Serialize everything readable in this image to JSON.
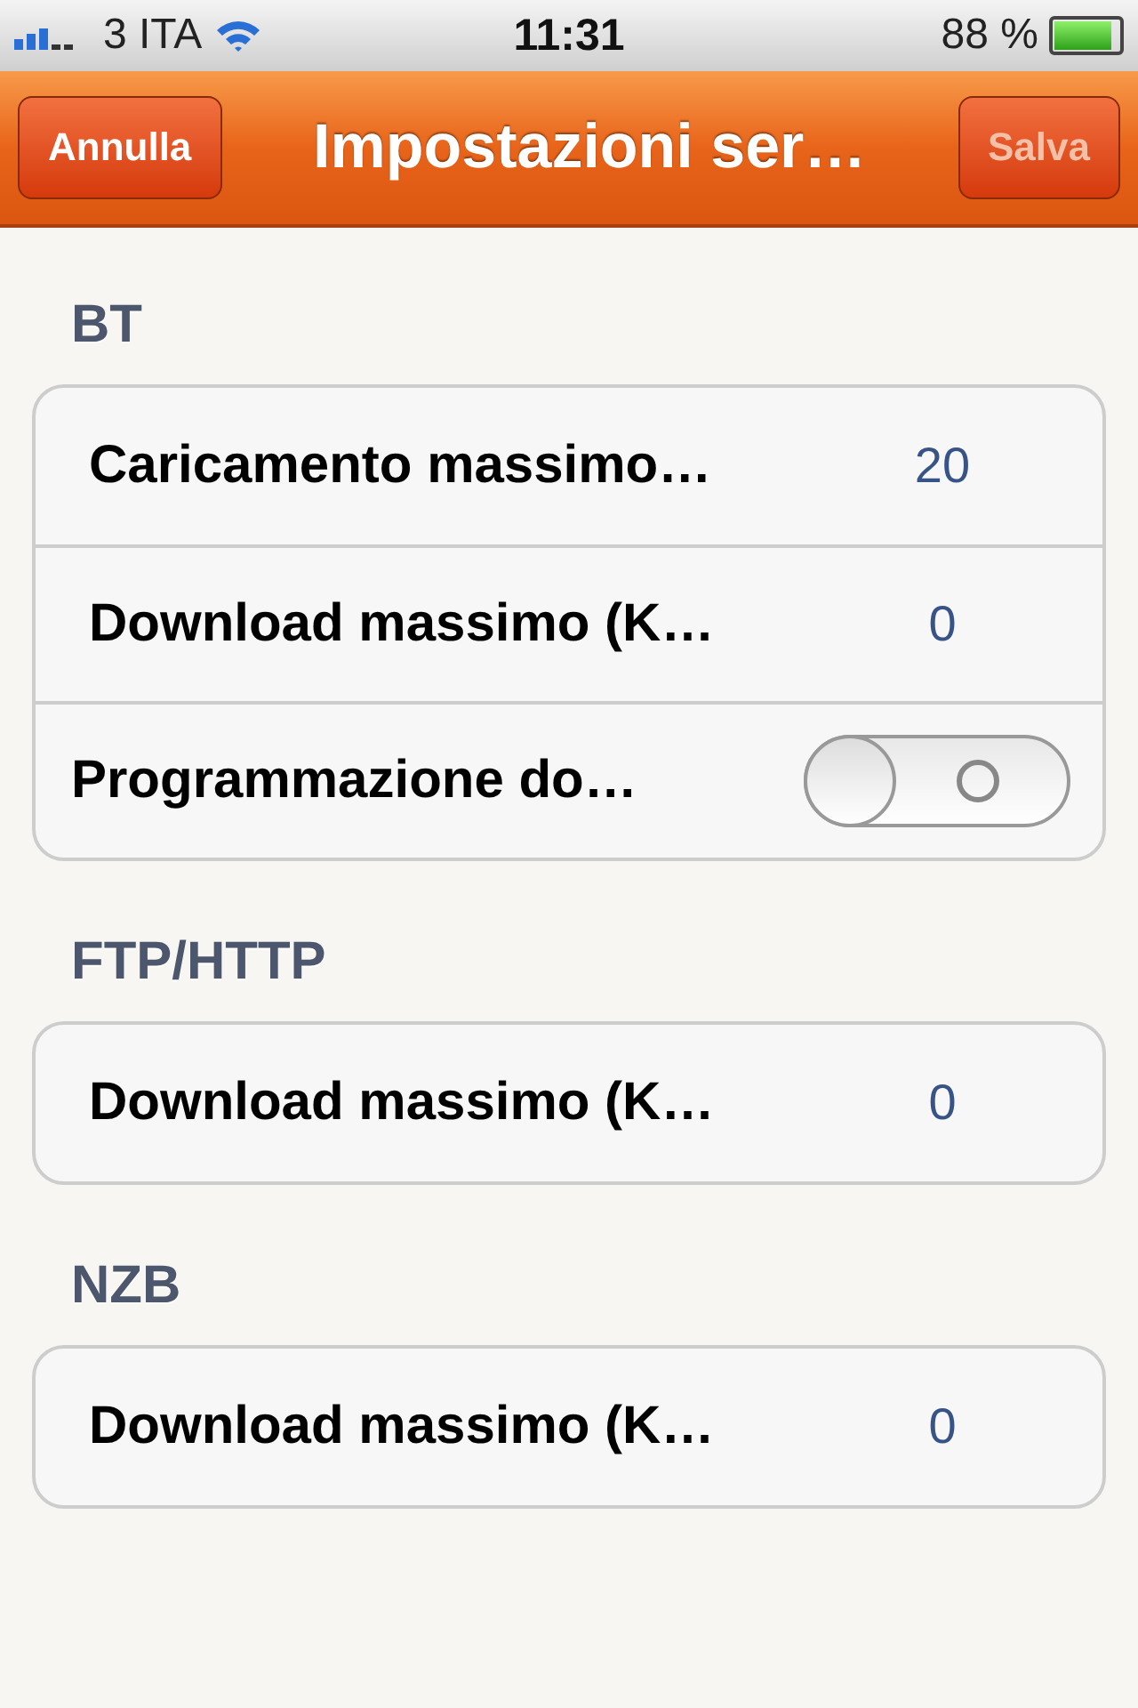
{
  "status_bar": {
    "carrier": "3 ITA",
    "time": "11:31",
    "battery": "88 %"
  },
  "nav_bar": {
    "left_button": {
      "label": "Annulla"
    },
    "title": "Impostazioni ser…",
    "right_button": {
      "label": "Salva",
      "disabled": true
    }
  },
  "sections": [
    {
      "header": "BT",
      "rows": [
        {
          "kind": "value",
          "label": "Caricamento massimo…",
          "value": "20"
        },
        {
          "kind": "value",
          "label": "Download massimo (K…",
          "value": "0"
        },
        {
          "kind": "switch",
          "label": "Programmazione do…",
          "on": false
        }
      ]
    },
    {
      "header": "FTP/HTTP",
      "rows": [
        {
          "kind": "value",
          "label": "Download massimo (K…",
          "value": "0"
        }
      ]
    },
    {
      "header": "NZB",
      "rows": [
        {
          "kind": "value",
          "label": "Download massimo (K…",
          "value": "0"
        }
      ]
    }
  ]
}
